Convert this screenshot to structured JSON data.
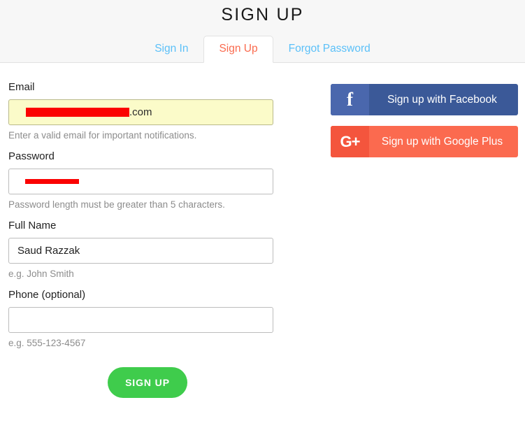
{
  "header": {
    "title": "SIGN UP"
  },
  "tabs": [
    {
      "label": "Sign In",
      "active": false
    },
    {
      "label": "Sign Up",
      "active": true
    },
    {
      "label": "Forgot Password",
      "active": false
    }
  ],
  "form": {
    "email": {
      "label": "Email",
      "value_suffix": ".com",
      "redacted": true,
      "hint": "Enter a valid email for important notifications."
    },
    "password": {
      "label": "Password",
      "redacted": true,
      "hint": "Password length must be greater than 5 characters."
    },
    "full_name": {
      "label": "Full Name",
      "value": "Saud Razzak",
      "hint": "e.g. John Smith"
    },
    "phone": {
      "label": "Phone (optional)",
      "value": "",
      "hint": "e.g. 555-123-4567"
    },
    "submit_label": "SIGN UP"
  },
  "social": {
    "facebook": {
      "label": "Sign up with Facebook",
      "glyph": "f",
      "icon_name": "facebook-icon",
      "body_color": "#3b5998",
      "icon_color": "#4a67ad"
    },
    "google_plus": {
      "label": "Sign up with Google Plus",
      "glyph": "G+",
      "icon_name": "google-plus-icon",
      "body_color": "#fb6a4f",
      "icon_color": "#f4553d"
    }
  },
  "colors": {
    "tab_active_text": "#fa6a4e",
    "tab_inactive_text": "#5bc0f8",
    "submit_green": "#3fcc4c",
    "autofill_yellow": "#fbfbc9",
    "redaction_red": "#fb0202",
    "header_bg": "#f7f7f7"
  }
}
